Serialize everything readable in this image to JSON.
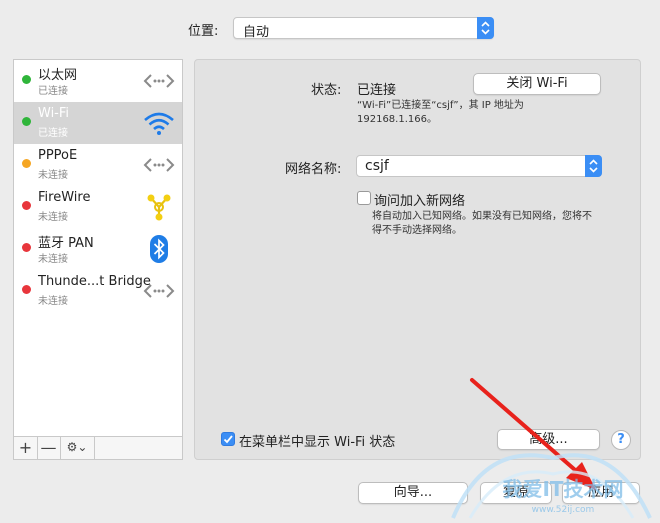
{
  "location": {
    "label": "位置:",
    "value": "自动"
  },
  "sidebar": {
    "items": [
      {
        "name": "以太网",
        "status": "已连接",
        "dot": "#2fb53a",
        "icon": "ethernet-icon"
      },
      {
        "name": "Wi-Fi",
        "status": "已连接",
        "dot": "#2fb53a",
        "icon": "wifi-icon",
        "selected": true
      },
      {
        "name": "PPPoE",
        "status": "未连接",
        "dot": "#f5a623",
        "icon": "ethernet-icon"
      },
      {
        "name": "FireWire",
        "status": "未连接",
        "dot": "#e8363c",
        "icon": "firewire-icon"
      },
      {
        "name": "蓝牙 PAN",
        "status": "未连接",
        "dot": "#e8363c",
        "icon": "bluetooth-icon"
      },
      {
        "name": "Thunde...t Bridge",
        "status": "未连接",
        "dot": "#e8363c",
        "icon": "ethernet-icon"
      }
    ],
    "bottom": {
      "add": "+",
      "remove": "—",
      "gear": "⚙︎⌄"
    }
  },
  "panel": {
    "status_label": "状态:",
    "status_value": "已连接",
    "turn_off_button": "关闭 Wi-Fi",
    "status_desc_line1": "“Wi-Fi”已连接至“csjf”，其 IP 地址为",
    "status_desc_line2": "192168.1.166。",
    "network_name_label": "网络名称:",
    "network_name_value": "csjf",
    "ask_join_label": "询问加入新网络",
    "ask_join_desc_line1": "将自动加入已知网络。如果没有已知网络，您将不",
    "ask_join_desc_line2": "得不手动选择网络。",
    "show_menubar_label": "在菜单栏中显示 Wi-Fi 状态",
    "advanced_button": "高级...",
    "help_button": "?"
  },
  "footer": {
    "assist_button": "向导...",
    "revert_button": "复原",
    "apply_button": "应用"
  },
  "watermark": {
    "text": "我爱IT技术网",
    "sub": "www.52ij.com"
  },
  "colors": {
    "accent": "#3b8ef5",
    "annotation_arrow": "#e8221c"
  }
}
